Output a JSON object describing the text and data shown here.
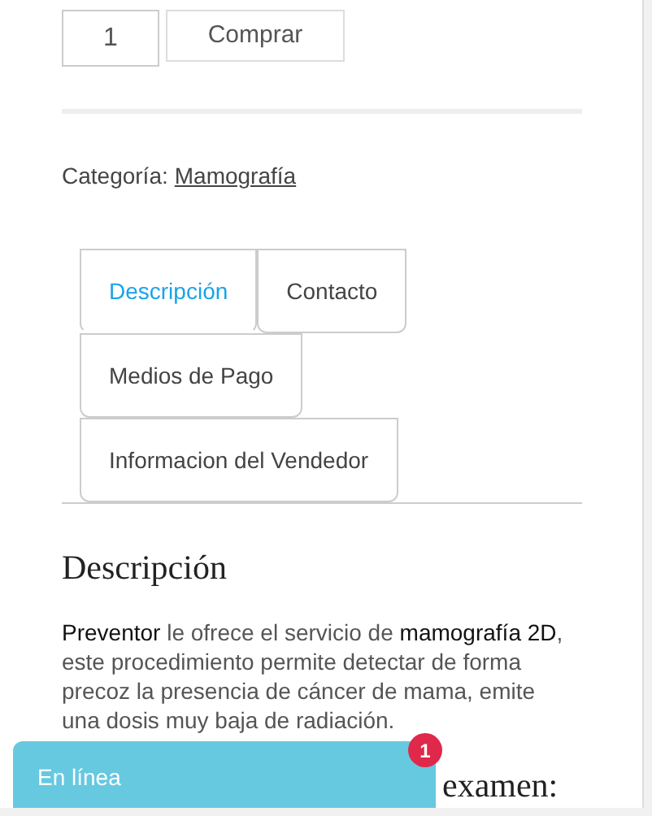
{
  "purchase": {
    "quantity": "1",
    "button": "Comprar"
  },
  "category": {
    "label": "Categoría:",
    "link": "Mamografía"
  },
  "tabs": [
    {
      "label": "Descripción",
      "selected": true
    },
    {
      "label": "Contacto",
      "selected": false
    },
    {
      "label": "Medios de Pago",
      "selected": false
    },
    {
      "label": "Informacion del Vendedor",
      "selected": false
    }
  ],
  "description": {
    "heading": "Descripción",
    "text": "**Preventor** le ofrece el servicio de **mamografía 2D**, este procedimiento permite detectar de forma precoz la presencia de cáncer de mama, emite una dosis muy baja de radiación.",
    "next_heading": "examen:"
  },
  "chat": {
    "label": "En línea",
    "badge": "1"
  }
}
